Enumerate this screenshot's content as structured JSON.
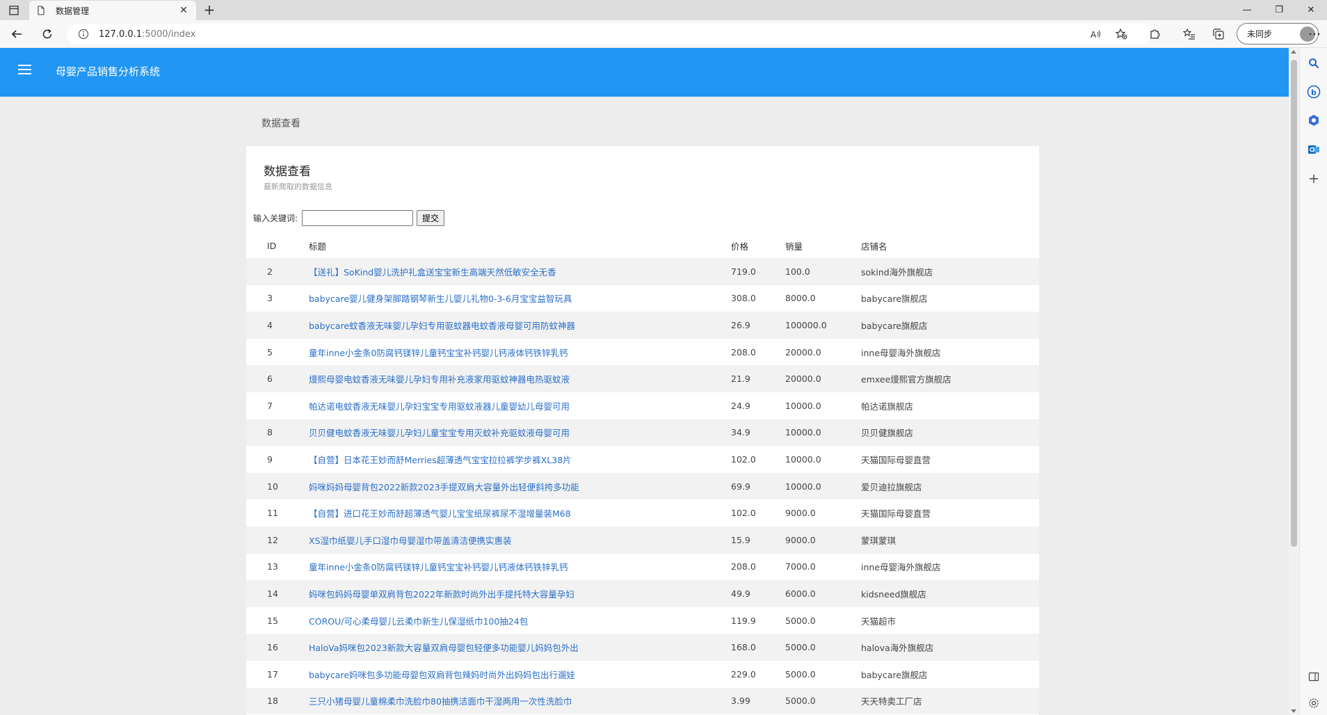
{
  "browser": {
    "tab_title": "数据管理",
    "url_host": "127.0.0.1",
    "url_path": ":5000/index",
    "profile_label": "未同步"
  },
  "app": {
    "title": "母婴产品销售分析系统",
    "breadcrumb": "数据查看"
  },
  "card": {
    "title": "数据查看",
    "subtitle": "最新爬取的数据信息",
    "search_label": "输入关键词:",
    "search_value": "",
    "submit_label": "提交"
  },
  "table": {
    "headers": {
      "id": "ID",
      "title": "标题",
      "price": "价格",
      "sales": "销量",
      "shop": "店铺名"
    },
    "rows": [
      {
        "id": "2",
        "title": "【送礼】SoKind婴儿洗护礼盒送宝宝新生高端天然低敏安全无香",
        "price": "719.0",
        "sales": "100.0",
        "shop": "sokind海外旗舰店"
      },
      {
        "id": "3",
        "title": "babycare婴儿健身架脚踏钢琴新生儿婴儿礼物0-3-6月宝宝益智玩具",
        "price": "308.0",
        "sales": "8000.0",
        "shop": "babycare旗舰店"
      },
      {
        "id": "4",
        "title": "babycare蚊香液无味婴儿孕妇专用驱蚊器电蚊香液母婴可用防蚊神器",
        "price": "26.9",
        "sales": "100000.0",
        "shop": "babycare旗舰店"
      },
      {
        "id": "5",
        "title": "童年inne小金条0防腐钙镁锌儿童钙宝宝补钙婴儿钙液体钙铁锌乳钙",
        "price": "208.0",
        "sales": "20000.0",
        "shop": "inne母婴海外旗舰店"
      },
      {
        "id": "6",
        "title": "熳熙母婴电蚊香液无味婴儿孕妇专用补充液家用驱蚊神器电热驱蚊液",
        "price": "21.9",
        "sales": "20000.0",
        "shop": "emxee熳熙官方旗舰店"
      },
      {
        "id": "7",
        "title": "帕达诺电蚊香液无味婴儿孕妇宝宝专用驱蚊液器儿童婴幼儿母婴可用",
        "price": "24.9",
        "sales": "10000.0",
        "shop": "帕达诺旗舰店"
      },
      {
        "id": "8",
        "title": "贝贝健电蚊香液无味婴儿孕妇儿童宝宝专用灭蚊补充驱蚊液母婴可用",
        "price": "34.9",
        "sales": "10000.0",
        "shop": "贝贝健旗舰店"
      },
      {
        "id": "9",
        "title": "【自营】日本花王妙而舒Merries超薄透气宝宝拉拉裤学步裤XL38片",
        "price": "102.0",
        "sales": "10000.0",
        "shop": "天猫国际母婴直营"
      },
      {
        "id": "10",
        "title": "妈咪妈妈母婴背包2022新款2023手提双肩大容量外出轻便斜挎多功能",
        "price": "69.9",
        "sales": "10000.0",
        "shop": "爱贝迪拉旗舰店"
      },
      {
        "id": "11",
        "title": "【自营】进口花王妙而舒超薄透气婴儿宝宝纸尿裤尿不湿增量装M68",
        "price": "102.0",
        "sales": "9000.0",
        "shop": "天猫国际母婴直营"
      },
      {
        "id": "12",
        "title": "XS湿巾纸婴儿手口湿巾母婴湿巾带盖清洁便携实惠装",
        "price": "15.9",
        "sales": "9000.0",
        "shop": "蒙琪蒙琪"
      },
      {
        "id": "13",
        "title": "童年inne小金条0防腐钙镁锌儿童钙宝宝补钙婴儿钙液体钙铁锌乳钙",
        "price": "208.0",
        "sales": "7000.0",
        "shop": "inne母婴海外旗舰店"
      },
      {
        "id": "14",
        "title": "妈咪包妈妈母婴单双肩背包2022年新款时尚外出手提托特大容量孕妇",
        "price": "49.9",
        "sales": "6000.0",
        "shop": "kidsneed旗舰店"
      },
      {
        "id": "15",
        "title": "COROU/可心柔母婴儿云柔巾新生儿保湿纸巾100抽24包",
        "price": "119.9",
        "sales": "5000.0",
        "shop": "天猫超市"
      },
      {
        "id": "16",
        "title": "HaloVa妈咪包2023新款大容量双肩母婴包轻便多功能婴儿妈妈包外出",
        "price": "168.0",
        "sales": "5000.0",
        "shop": "halova海外旗舰店"
      },
      {
        "id": "17",
        "title": "babycare妈咪包多功能母婴包双肩背包辣妈时尚外出妈妈包出行遛娃",
        "price": "229.0",
        "sales": "5000.0",
        "shop": "babycare旗舰店"
      },
      {
        "id": "18",
        "title": "三只小猪母婴儿童棉柔巾洗脸巾80抽携洁面巾干湿两用一次性洗脸巾",
        "price": "3.99",
        "sales": "5000.0",
        "shop": "天天特卖工厂店"
      }
    ]
  },
  "icons": {
    "accent_header": "#2196f3",
    "link_color": "#2a6fc9"
  }
}
